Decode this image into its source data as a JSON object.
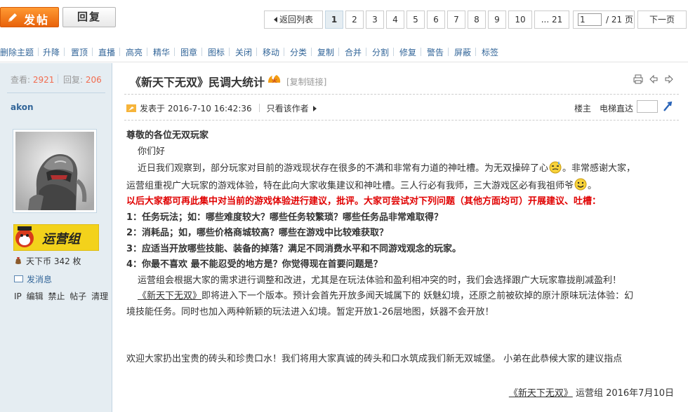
{
  "toolbar": {
    "post_label": "发帖",
    "reply_label": "回复"
  },
  "pagination": {
    "back_label": "返回列表",
    "pages": [
      "1",
      "2",
      "3",
      "4",
      "5",
      "6",
      "7",
      "8",
      "9",
      "10"
    ],
    "last_page": "... 21",
    "current_input": "1",
    "total": "/ 21 页",
    "next_label": "下一页"
  },
  "mod_actions": [
    "删除主题",
    "升降",
    "置顶",
    "直播",
    "高亮",
    "精华",
    "图章",
    "图标",
    "关闭",
    "移动",
    "分类",
    "复制",
    "合并",
    "分割",
    "修复",
    "警告",
    "屏蔽",
    "标签"
  ],
  "sidebar": {
    "views_label": "查看:",
    "views": "2921",
    "replies_label": "回复:",
    "replies": "206",
    "author": "akon",
    "badge_text": "运营组",
    "coin_text": "天下币 342 枚",
    "message_label": "发消息",
    "ip_items": [
      "IP",
      "编辑",
      "禁止",
      "帖子",
      "清理"
    ]
  },
  "post": {
    "title": "《新天下无双》民调大统计",
    "hot_label": "火",
    "copy_link": "[复制链接]",
    "posted_at": "发表于 2016-7-10 16:42:36",
    "only_author": "只看该作者",
    "floor_label": "楼主",
    "lift_label": "电梯直达",
    "lines": {
      "l1": "尊敬的各位无双玩家",
      "l2": "你们好",
      "l3a": "近日我们观察到，部分玩家对目前的游戏现状存在很多的不满和非常有力道的神吐槽。为无双操碎了心",
      "l3b": "。非常感谢大家，",
      "l4a": "运营组重视广大玩家的游戏体验，特在此向大家收集建议和神吐槽。三人行必有我师，三大游戏区必有我祖师爷",
      "l4b": "。",
      "l5": "以后大家都可再此集中对当前的游戏体验进行建议，批评。大家可尝试对下列问题（其他方面均可）开展建议、吐槽：",
      "l6": "1：任务玩法；如：哪些难度较大？哪些任务较繁琐？哪些任务品非常难取得？",
      "l7": "2：消耗品；如，哪些价格商城较高？哪些在游戏中比较难获取？",
      "l8": "3：应适当开放哪些技能、装备的掉落？满足不同消费水平和不同游戏观念的玩家。",
      "l9": "4：你最不喜欢 最不能忍受的地方是？你觉得现在首要问题是？",
      "l10": "运营组会根据大家的需求进行调整和改进，尤其是在玩法体验和盈利相冲突的时，我们会选择跟广大玩家靠拢削减盈利！",
      "l11a": "《新天下无双》",
      "l11b": "即将进入下一个版本。预计会首先开放多闻天城属下的 妖魅幻境，还原之前被砍掉的原汁原味玩法体验：幻",
      "l12": "境技能任务。同时也加入两种新颖的玩法进入幻境。暂定开放1-26层地图，妖器不会开放！",
      "l13": "欢迎大家扔出宝贵的砖头和珍贵口水！我们将用大家真诚的砖头和口水筑成我们新无双城堡。 小弟在此恭候大家的建议指点",
      "sign_a": "《新天下无双》",
      "sign_b": "运营组 2016年7月10日"
    }
  },
  "colors": {
    "accent_orange": "#e8620a",
    "link_blue": "#336699",
    "sidebar_bg": "#e5edf2",
    "highlight_red": "#e00000",
    "count_red": "#f26c4f"
  }
}
